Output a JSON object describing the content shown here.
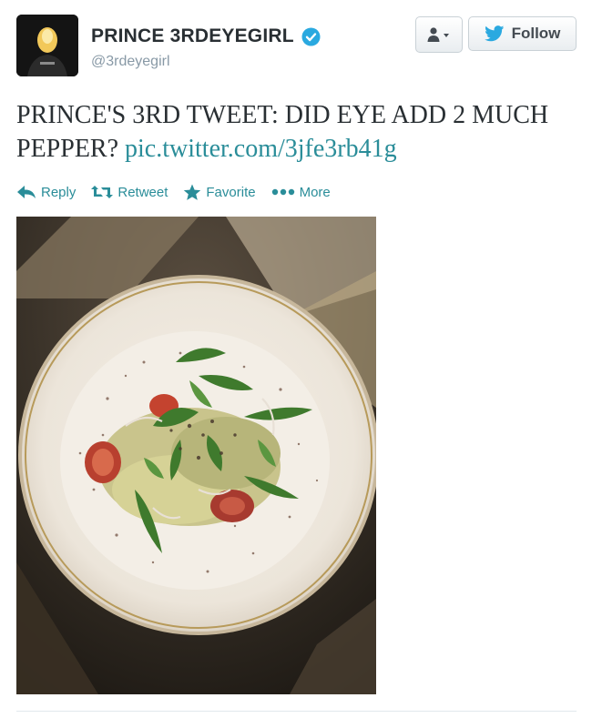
{
  "profile": {
    "name": "PRINCE 3RDEYEGIRL",
    "handle": "@3rdeyegirl",
    "verified": true
  },
  "buttons": {
    "user_menu_icon": "person-dropdown-icon",
    "follow_label": "Follow"
  },
  "tweet": {
    "text": "PRINCE'S 3RD TWEET: DID EYE ADD 2 MUCH PEPPER?",
    "link": "pic.twitter.com/3jfe3rb41g"
  },
  "actions": [
    {
      "label": "Reply",
      "icon": "reply-icon"
    },
    {
      "label": "Retweet",
      "icon": "retweet-icon"
    },
    {
      "label": "Favorite",
      "icon": "star-icon"
    },
    {
      "label": "More",
      "icon": "more-dots-icon"
    }
  ],
  "colors": {
    "accent": "#2a8d99",
    "twitter_blue": "#2aa9e0",
    "verified": "#2aa9e0",
    "secondary_text": "#8899a6"
  }
}
